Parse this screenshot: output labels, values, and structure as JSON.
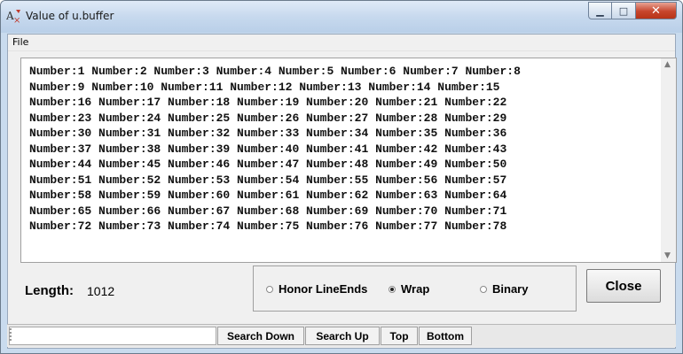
{
  "window": {
    "title": "Value of u.buffer"
  },
  "menu": {
    "file": "File"
  },
  "buffer": {
    "lines": [
      "Number:1 Number:2 Number:3 Number:4 Number:5 Number:6 Number:7 Number:8",
      "Number:9 Number:10 Number:11 Number:12 Number:13 Number:14 Number:15",
      "Number:16 Number:17 Number:18 Number:19 Number:20 Number:21 Number:22",
      "Number:23 Number:24 Number:25 Number:26 Number:27 Number:28 Number:29",
      "Number:30 Number:31 Number:32 Number:33 Number:34 Number:35 Number:36",
      "Number:37 Number:38 Number:39 Number:40 Number:41 Number:42 Number:43",
      "Number:44 Number:45 Number:46 Number:47 Number:48 Number:49 Number:50",
      "Number:51 Number:52 Number:53 Number:54 Number:55 Number:56 Number:57",
      "Number:58 Number:59 Number:60 Number:61 Number:62 Number:63 Number:64",
      "Number:65 Number:66 Number:67 Number:68 Number:69 Number:70 Number:71",
      "Number:72 Number:73 Number:74 Number:75 Number:76 Number:77 Number:78"
    ]
  },
  "status": {
    "length_label": "Length:",
    "length_value": "1012"
  },
  "options": {
    "honor_lineends": "Honor LineEnds",
    "wrap": "Wrap",
    "binary": "Binary",
    "selected": "wrap"
  },
  "buttons": {
    "close": "Close",
    "search_down": "Search Down",
    "search_up": "Search Up",
    "top": "Top",
    "bottom": "Bottom"
  },
  "search": {
    "value": ""
  },
  "icons": {
    "app": "font-icon",
    "close": "close-icon",
    "maximize": "maximize-icon",
    "minimize": "minimize-icon"
  }
}
